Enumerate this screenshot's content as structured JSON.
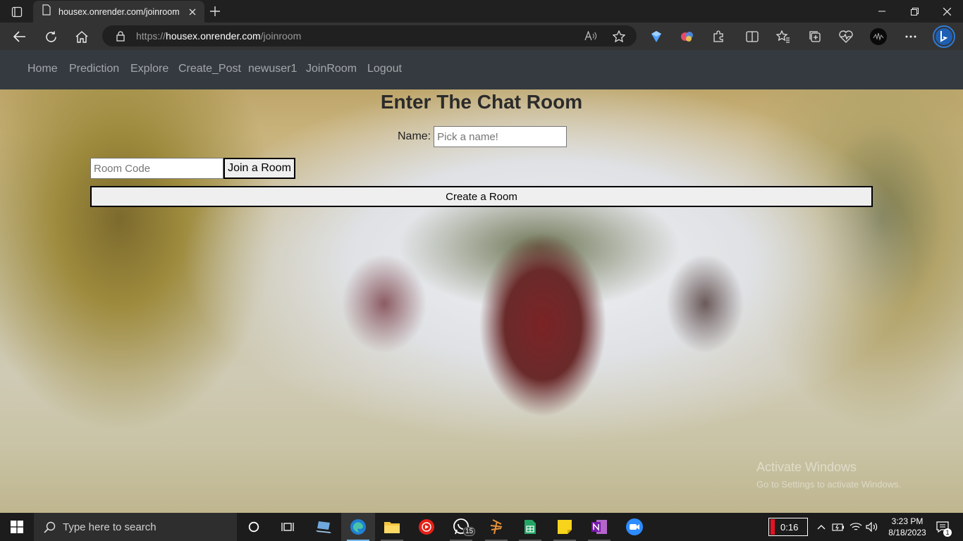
{
  "browser": {
    "tab_title": "housex.onrender.com/joinroom",
    "url_prefix": "https://",
    "url_host": "housex.onrender.com",
    "url_path": "/joinroom",
    "icons": [
      "tab-actions-icon",
      "page-icon",
      "close-icon",
      "plus-icon",
      "minimize-icon",
      "restore-icon",
      "window-close-icon",
      "back-icon",
      "refresh-icon",
      "home-icon",
      "lock-icon",
      "read-aloud-icon",
      "favorite-star-icon",
      "extension-icon",
      "split-screen-icon",
      "favorites-icon",
      "collections-icon",
      "health-icon",
      "profile-avatar",
      "more-icon",
      "bing-icon"
    ]
  },
  "nav": {
    "items": [
      {
        "label": "Home"
      },
      {
        "label": "Prediction"
      },
      {
        "label": "Explore"
      },
      {
        "label": "Create_Post"
      },
      {
        "label": "newuser1"
      },
      {
        "label": "JoinRoom"
      },
      {
        "label": "Logout"
      }
    ]
  },
  "room": {
    "title": "Enter The Chat Room",
    "name_label": "Name:",
    "name_placeholder": "Pick a name!",
    "code_placeholder": "Room Code",
    "join_label": "Join a Room",
    "create_label": "Create a Room"
  },
  "watermark": {
    "title": "Activate Windows",
    "subtitle": "Go to Settings to activate Windows."
  },
  "taskbar": {
    "search_placeholder": "Type here to search",
    "whatsapp_badge": "15",
    "battery_time": "0:16",
    "time": "3:23 PM",
    "date": "8/18/2023",
    "notification_count": "1",
    "colors": {
      "accent": "#76b9ed",
      "battery_low": "#e81123"
    }
  }
}
